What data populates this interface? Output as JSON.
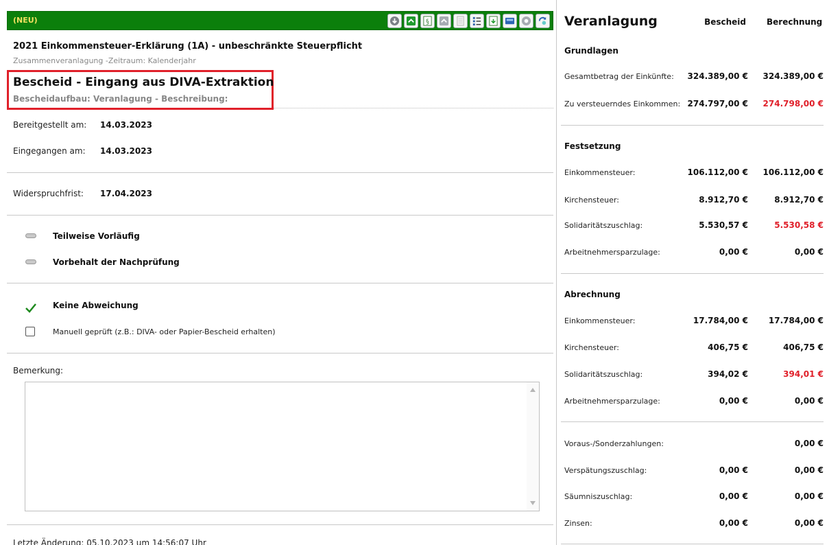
{
  "header": {
    "status": "(NEU)"
  },
  "toolbar": [
    {
      "name": "download-icon"
    },
    {
      "name": "next-icon"
    },
    {
      "name": "paragraph-doc-icon"
    },
    {
      "name": "collapse-icon"
    },
    {
      "name": "document-icon"
    },
    {
      "name": "list-icon"
    },
    {
      "name": "export-icon"
    },
    {
      "name": "calculator-icon"
    },
    {
      "name": "record-icon"
    },
    {
      "name": "refresh-icon"
    }
  ],
  "doc": {
    "title": "2021 Einkommensteuer-Erklärung (1A) - unbeschränkte Steuerpflicht",
    "subtitle": "Zusammenveranlagung -Zeitraum: Kalenderjahr"
  },
  "bescheid": {
    "title": "Bescheid - Eingang aus DIVA-Extraktion",
    "subtitle": "Bescheidaufbau: Veranlagung - Beschreibung:"
  },
  "dates": {
    "bereitgestellt_label": "Bereitgestellt am:",
    "bereitgestellt_value": "14.03.2023",
    "eingegangen_label": "Eingegangen am:",
    "eingegangen_value": "14.03.2023",
    "frist_label": "Widerspruchfrist:",
    "frist_value": "17.04.2023"
  },
  "flags": {
    "teilweise": "Teilweise Vorläufig",
    "vorbehalt": "Vorbehalt der Nachprüfung",
    "keine_abweichung": "Keine Abweichung",
    "manuell": "Manuell geprüft (z.B.: DIVA- oder Papier-Bescheid erhalten)",
    "manuell_checked": false
  },
  "remark": {
    "label": "Bemerkung:",
    "value": ""
  },
  "footer": {
    "last_change": "Letzte Änderung: 05.10.2023 um 14:56:07 Uhr"
  },
  "colors": {
    "header_green": "#0b7f0b",
    "highlight_red": "#e0202a",
    "diff_red": "#e0202a"
  },
  "summary": {
    "title": "Veranlagung",
    "col1": "Bescheid",
    "col2": "Berechnung",
    "grundlagen": {
      "title": "Grundlagen",
      "rows": [
        {
          "label": "Gesamtbetrag der Einkünfte:",
          "bescheid": "324.389,00 €",
          "berechnung": "324.389,00 €",
          "diff": false
        },
        {
          "label": "Zu versteuerndes Einkommen:",
          "bescheid": "274.797,00 €",
          "berechnung": "274.798,00 €",
          "diff": true
        }
      ]
    },
    "festsetzung": {
      "title": "Festsetzung",
      "rows": [
        {
          "label": "Einkommensteuer:",
          "bescheid": "106.112,00 €",
          "berechnung": "106.112,00 €",
          "diff": false
        },
        {
          "label": "Kirchensteuer:",
          "bescheid": "8.912,70 €",
          "berechnung": "8.912,70 €",
          "diff": false
        },
        {
          "label": "Solidaritätszuschlag:",
          "bescheid": "5.530,57 €",
          "berechnung": "5.530,58 €",
          "diff": true
        },
        {
          "label": "Arbeitnehmersparzulage:",
          "bescheid": "0,00 €",
          "berechnung": "0,00 €",
          "diff": false
        }
      ]
    },
    "abrechnung": {
      "title": "Abrechnung",
      "rows": [
        {
          "label": "Einkommensteuer:",
          "bescheid": "17.784,00 €",
          "berechnung": "17.784,00 €",
          "diff": false
        },
        {
          "label": "Kirchensteuer:",
          "bescheid": "406,75 €",
          "berechnung": "406,75 €",
          "diff": false
        },
        {
          "label": "Solidaritätszuschlag:",
          "bescheid": "394,02 €",
          "berechnung": "394,01 €",
          "diff": true
        },
        {
          "label": "Arbeitnehmersparzulage:",
          "bescheid": "0,00 €",
          "berechnung": "0,00 €",
          "diff": false
        }
      ]
    },
    "sonstiges": {
      "rows": [
        {
          "label": "Voraus-/Sonderzahlungen:",
          "bescheid": "",
          "berechnung": "0,00 €",
          "diff": false
        },
        {
          "label": "Verspätungszuschlag:",
          "bescheid": "0,00 €",
          "berechnung": "0,00 €",
          "diff": false
        },
        {
          "label": "Säumniszuschlag:",
          "bescheid": "0,00 €",
          "berechnung": "0,00 €",
          "diff": false
        },
        {
          "label": "Zinsen:",
          "bescheid": "0,00 €",
          "berechnung": "0,00 €",
          "diff": false
        }
      ]
    }
  }
}
